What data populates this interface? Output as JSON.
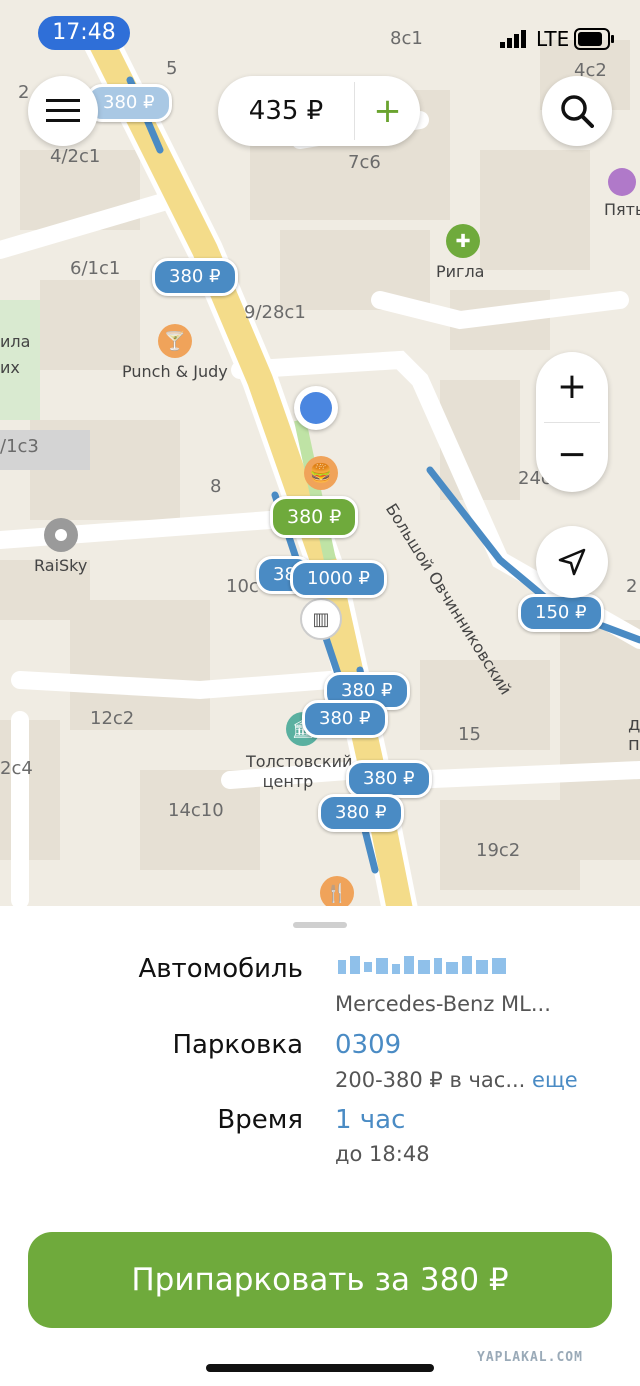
{
  "status_bar": {
    "time": "17:48",
    "network": "LTE"
  },
  "top": {
    "balance": "435 ₽",
    "add": "+"
  },
  "map": {
    "labels": [
      "8с1",
      "5",
      "2",
      "4/2с1",
      "7с6",
      "4с2",
      "Пять",
      "6/1с1",
      "9/28с1",
      "ила",
      "их",
      "/1с3",
      "8",
      "24с",
      "10с",
      "2",
      "12с2",
      "15",
      "2с4",
      "14с10",
      "19с2",
      "д",
      "п",
      "Большой Овчинниковский"
    ],
    "pois": [
      {
        "name": "Ригла",
        "icon": "pharmacy-icon"
      },
      {
        "name": "Punch & Judy",
        "icon": "bar-icon"
      },
      {
        "name": "RaiSky",
        "icon": "place-icon"
      },
      {
        "name": "Толстовский\nцентр",
        "icon": "museum-icon"
      }
    ],
    "pins": [
      "380 ₽",
      "380 ₽",
      "380 ₽",
      "38",
      "1000 ₽",
      "150 ₽",
      "380 ₽",
      "380 ₽",
      "380 ₽",
      "380 ₽"
    ],
    "controls": {
      "zoom_in": "+",
      "zoom_out": "−"
    }
  },
  "sheet": {
    "car_label": "Автомобиль",
    "car_value": "Mercedes-Benz ML...",
    "parking_label": "Парковка",
    "parking_value": "0309",
    "parking_rate": "200-380 ₽ в час...",
    "parking_more": "еще",
    "time_label": "Время",
    "time_value": "1 час",
    "time_until": "до 18:48",
    "park_button": "Припарковать за 380 ₽"
  },
  "watermark": "YAPLAKAL.COM",
  "colors": {
    "accent_green": "#6faa3c",
    "pin_blue": "#4a8bc4",
    "time_pill": "#2f6fd8"
  }
}
